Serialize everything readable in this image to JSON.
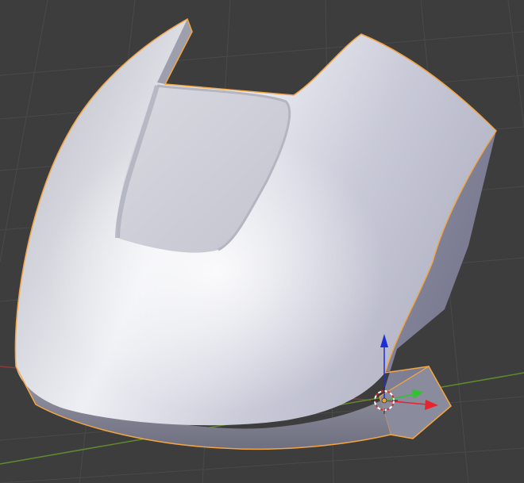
{
  "viewport": {
    "background_color": "#3d3d3d",
    "grid_color": "#4a4a4a",
    "x_axis_color": "#8b3b3b",
    "y_axis_color": "#5f8a2e",
    "selection_outline_color": "#f3a544"
  },
  "object": {
    "type": "mesh",
    "selected": true,
    "shading": "smooth"
  },
  "gizmo": {
    "x_axis_color": "#e8232d",
    "y_axis_color": "#2ec42e",
    "z_axis_color": "#1f2fd8",
    "origin_color": "#e8a23a"
  }
}
